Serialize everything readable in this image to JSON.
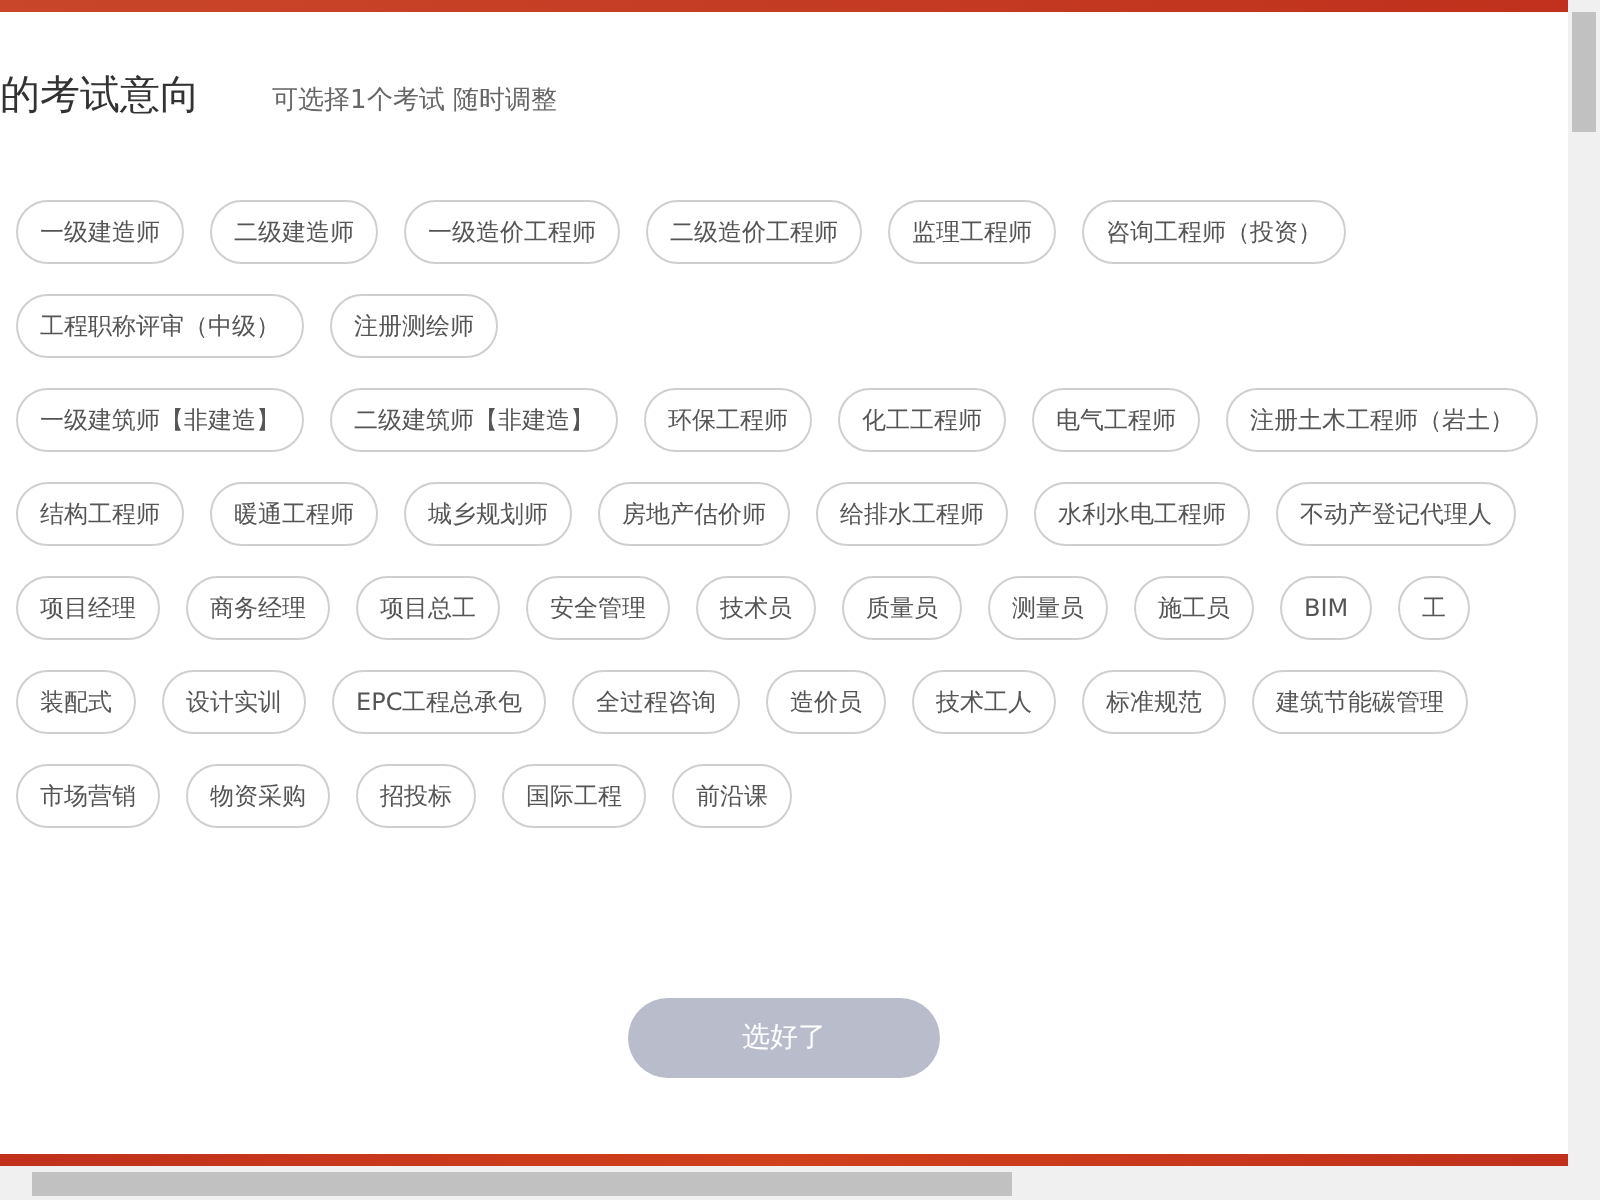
{
  "header": {
    "title": "的考试意向",
    "subtitle": "可选择1个考试 随时调整"
  },
  "rows": [
    [
      {
        "label": "一级建造师",
        "selected": false
      },
      {
        "label": "二级建造师",
        "selected": false
      },
      {
        "label": "一级造价工程师",
        "selected": false
      },
      {
        "label": "二级造价工程师",
        "selected": false
      },
      {
        "label": "监理工程师",
        "selected": false
      },
      {
        "label": "咨询工程师（投资）",
        "selected": false
      }
    ],
    [
      {
        "label": "工程职称评审（中级）",
        "selected": false
      },
      {
        "label": "注册测绘师",
        "selected": false
      }
    ],
    [
      {
        "label": "一级建筑师【非建造】",
        "selected": false
      },
      {
        "label": "二级建筑师【非建造】",
        "selected": false
      },
      {
        "label": "环保工程师",
        "selected": false
      },
      {
        "label": "化工工程师",
        "selected": false
      },
      {
        "label": "电气工程师",
        "selected": false
      },
      {
        "label": "注册土木工程师（岩土）",
        "selected": false
      }
    ],
    [
      {
        "label": "结构工程师",
        "selected": false
      },
      {
        "label": "暖通工程师",
        "selected": false
      },
      {
        "label": "城乡规划师",
        "selected": false
      },
      {
        "label": "房地产估价师",
        "selected": false
      },
      {
        "label": "给排水工程师",
        "selected": false
      },
      {
        "label": "水利水电工程师",
        "selected": false
      },
      {
        "label": "不动产登记代理人",
        "selected": false
      }
    ],
    [
      {
        "label": "项目经理",
        "selected": false
      },
      {
        "label": "商务经理",
        "selected": false
      },
      {
        "label": "项目总工",
        "selected": false
      },
      {
        "label": "安全管理",
        "selected": false
      },
      {
        "label": "技术员",
        "selected": false
      },
      {
        "label": "质量员",
        "selected": false
      },
      {
        "label": "测量员",
        "selected": false
      },
      {
        "label": "施工员",
        "selected": false
      },
      {
        "label": "BIM",
        "selected": false
      },
      {
        "label": "工",
        "selected": false
      }
    ],
    [
      {
        "label": "装配式",
        "selected": false
      },
      {
        "label": "设计实训",
        "selected": false
      },
      {
        "label": "EPC工程总承包",
        "selected": false
      },
      {
        "label": "全过程咨询",
        "selected": false
      },
      {
        "label": "造价员",
        "selected": false
      },
      {
        "label": "技术工人",
        "selected": false
      },
      {
        "label": "标准规范",
        "selected": false
      },
      {
        "label": "建筑节能碳管理",
        "selected": false
      }
    ],
    [
      {
        "label": "市场营销",
        "selected": false
      },
      {
        "label": "物资采购",
        "selected": false
      },
      {
        "label": "招投标",
        "selected": false
      },
      {
        "label": "国际工程",
        "selected": false
      },
      {
        "label": "前沿课",
        "selected": false
      }
    ]
  ],
  "confirm_button": {
    "label": "选好了",
    "disabled": true
  }
}
